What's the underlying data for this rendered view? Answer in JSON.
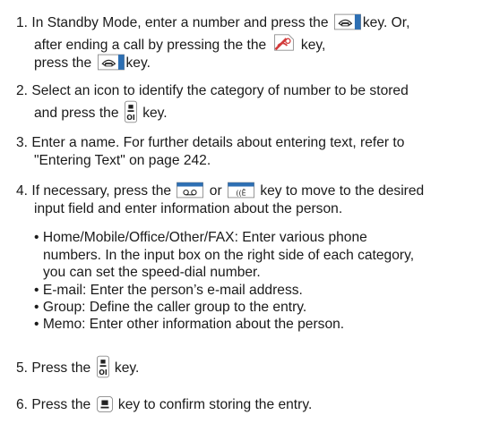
{
  "steps": [
    {
      "number": "1.",
      "line1_a": "In Standby Mode, enter a number and press the",
      "line1_b": "key. Or,",
      "line2_a": "after ending a call by pressing the the",
      "line2_b": "key,",
      "line3_a": "press the",
      "line3_b": "key.",
      "icons": [
        "send-key-icon",
        "end-key-icon",
        "send-key-icon"
      ]
    },
    {
      "number": "2.",
      "line1": "Select an icon to identify the category of number to be stored",
      "line2_a": "and press the",
      "line2_b": "key.",
      "icons": [
        "ok-key-icon"
      ]
    },
    {
      "number": "3.",
      "line1": "Enter a name. For further details about entering text, refer to",
      "line2": "\"Entering Text\" on page 242."
    },
    {
      "number": "4.",
      "line1_a": "If necessary, press the",
      "line1_b": "or",
      "line1_c": "key to move to the desired",
      "line2": "input field and enter information about the person.",
      "icons": [
        "voicemail-key-icon",
        "clear-key-icon"
      ]
    },
    {
      "number": "5.",
      "line1_a": "Press the",
      "line1_b": "key.",
      "icons": [
        "ok-key-icon"
      ]
    },
    {
      "number": "6.",
      "line1_a": "Press the",
      "line1_b": "key to confirm storing the entry.",
      "icons": [
        "ok-key-icon"
      ]
    }
  ],
  "bullets": [
    {
      "symbol": "•",
      "lines": [
        "Home/Mobile/Office/Other/FAX: Enter various phone",
        "numbers. In the input box on the right side of each category,",
        "you can set the speed-dial number."
      ]
    },
    {
      "symbol": "•",
      "lines": [
        "E-mail: Enter the person’s e-mail address."
      ]
    },
    {
      "symbol": "•",
      "lines": [
        "Group: Define the caller group to the entry."
      ]
    },
    {
      "symbol": "•",
      "lines": [
        "Memo: Enter other information about the person."
      ]
    }
  ],
  "colors": {
    "text": "#1a1a1a",
    "key_blue": "#2d6fb3",
    "key_red": "#d23a3a",
    "key_border": "#8a8a8a"
  }
}
